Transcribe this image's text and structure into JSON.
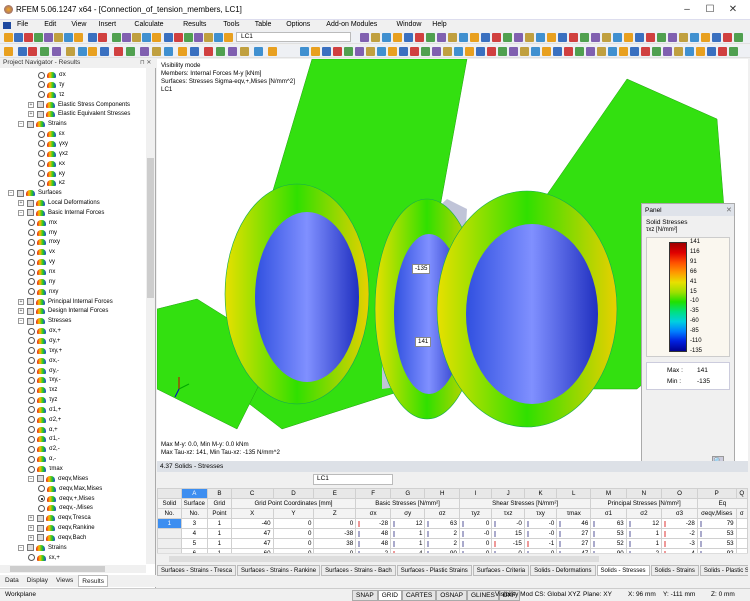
{
  "app": {
    "title": "RFEM 5.06.1247 x64 - [Connection_of_tension_members, LC1]"
  },
  "menu": [
    "File",
    "Edit",
    "View",
    "Insert",
    "Calculate",
    "Results",
    "Tools",
    "Table",
    "Options",
    "Add-on Modules",
    "Window",
    "Help"
  ],
  "toolbar": {
    "loadcase": "LC1"
  },
  "navigator": {
    "title": "Project Navigator - Results",
    "items": [
      {
        "l": 3,
        "t": "r",
        "label": "σx"
      },
      {
        "l": 3,
        "t": "r",
        "label": "τy"
      },
      {
        "l": 3,
        "t": "r",
        "label": "τz"
      },
      {
        "l": 2,
        "t": "e",
        "label": "Elastic Stress Components"
      },
      {
        "l": 2,
        "t": "e",
        "label": "Elastic Equivalent Stresses"
      },
      {
        "l": 1,
        "t": "c",
        "label": "Strains"
      },
      {
        "l": 3,
        "t": "r",
        "label": "εx"
      },
      {
        "l": 3,
        "t": "r",
        "label": "γxy"
      },
      {
        "l": 3,
        "t": "r",
        "label": "γxz"
      },
      {
        "l": 3,
        "t": "r",
        "label": "κx"
      },
      {
        "l": 3,
        "t": "r",
        "label": "κy"
      },
      {
        "l": 3,
        "t": "r",
        "label": "κz"
      },
      {
        "l": 0,
        "t": "c",
        "label": "Surfaces"
      },
      {
        "l": 1,
        "t": "e",
        "label": "Local Deformations"
      },
      {
        "l": 1,
        "t": "c",
        "label": "Basic Internal Forces"
      },
      {
        "l": 2,
        "t": "r",
        "label": "mx"
      },
      {
        "l": 2,
        "t": "r",
        "label": "my"
      },
      {
        "l": 2,
        "t": "r",
        "label": "mxy"
      },
      {
        "l": 2,
        "t": "r",
        "label": "vx"
      },
      {
        "l": 2,
        "t": "r",
        "label": "vy"
      },
      {
        "l": 2,
        "t": "r",
        "label": "nx"
      },
      {
        "l": 2,
        "t": "r",
        "label": "ny"
      },
      {
        "l": 2,
        "t": "r",
        "label": "nxy"
      },
      {
        "l": 1,
        "t": "e",
        "label": "Principal Internal Forces"
      },
      {
        "l": 1,
        "t": "e",
        "label": "Design Internal Forces"
      },
      {
        "l": 1,
        "t": "c",
        "label": "Stresses"
      },
      {
        "l": 2,
        "t": "r",
        "label": "σx,+"
      },
      {
        "l": 2,
        "t": "r",
        "label": "σy,+"
      },
      {
        "l": 2,
        "t": "r",
        "label": "τxy,+"
      },
      {
        "l": 2,
        "t": "r",
        "label": "σx,-"
      },
      {
        "l": 2,
        "t": "r",
        "label": "σy,-"
      },
      {
        "l": 2,
        "t": "r",
        "label": "τxy,-"
      },
      {
        "l": 2,
        "t": "r",
        "label": "τxz"
      },
      {
        "l": 2,
        "t": "r",
        "label": "τyz"
      },
      {
        "l": 2,
        "t": "r",
        "label": "σ1,+"
      },
      {
        "l": 2,
        "t": "r",
        "label": "σ2,+"
      },
      {
        "l": 2,
        "t": "r",
        "label": "α,+"
      },
      {
        "l": 2,
        "t": "r",
        "label": "σ1,-"
      },
      {
        "l": 2,
        "t": "r",
        "label": "σ2,-"
      },
      {
        "l": 2,
        "t": "r",
        "label": "α,-"
      },
      {
        "l": 2,
        "t": "r",
        "label": "τmax"
      },
      {
        "l": 2,
        "t": "c",
        "label": "σeqv,Mises"
      },
      {
        "l": 3,
        "t": "r",
        "label": "σeqv,Max,Mises"
      },
      {
        "l": 3,
        "t": "r",
        "label": "σeqv,+,Mises",
        "checked": true
      },
      {
        "l": 3,
        "t": "r",
        "label": "σeqv,-,Mises"
      },
      {
        "l": 2,
        "t": "e",
        "label": "σeqv,Tresca"
      },
      {
        "l": 2,
        "t": "e",
        "label": "σeqv,Rankine"
      },
      {
        "l": 2,
        "t": "e",
        "label": "σeqv,Bach"
      },
      {
        "l": 1,
        "t": "c",
        "label": "Strains"
      },
      {
        "l": 2,
        "t": "r",
        "label": "εx,+"
      }
    ],
    "tabs": [
      "Data",
      "Display",
      "Views",
      "Results"
    ],
    "active_tab": "Results"
  },
  "viewport": {
    "info": [
      "Visibility mode",
      "Members: Internal Forces M-y [kNm]",
      "Surfaces: Stresses Sigma-eqv,+,Mises [N/mm^2]",
      "LC1"
    ],
    "footer": [
      "Max M-y: 0.0, Min M-y: 0.0 kNm",
      "Max Tau-xz: 141, Min Tau-xz: -135 N/mm^2"
    ],
    "labels": [
      "-135",
      "141"
    ]
  },
  "panel": {
    "title": "Panel",
    "heading": "Solid Stresses",
    "unit": "τxz [N/mm²]",
    "scale": [
      "141",
      "116",
      "91",
      "66",
      "41",
      "15",
      "-10",
      "-35",
      "-60",
      "-85",
      "-110",
      "-135"
    ],
    "colors": [
      "#a00000",
      "#e00000",
      "#ff5000",
      "#ff9900",
      "#e8e000",
      "#a0e000",
      "#20e000",
      "#00e080",
      "#00d0e0",
      "#0080ff",
      "#0020e0",
      "#000090"
    ],
    "max_label": "Max :",
    "max": "141",
    "min_label": "Min :",
    "min": "-135"
  },
  "table": {
    "title": "4.37 Solids - Stresses",
    "loadcase": "LC1",
    "col_letters": [
      "A",
      "B",
      "C",
      "D",
      "E",
      "F",
      "G",
      "H",
      "I",
      "J",
      "K",
      "L",
      "M",
      "N",
      "O",
      "P",
      "Q"
    ],
    "groups": [
      "Grid Point Coordinates [mm]",
      "Basic Stresses [N/mm²]",
      "Shear Stresses [N/mm²]",
      "Principal Stresses [N/mm²]",
      "Eq"
    ],
    "headers_top": [
      "Solid",
      "Surface",
      "Grid"
    ],
    "headers_bottom": [
      "No.",
      "No.",
      "Point",
      "X",
      "Y",
      "Z",
      "σx",
      "σy",
      "σz",
      "τyz",
      "τxz",
      "τxy",
      "τmax",
      "σ1",
      "σ2",
      "σ3",
      "σeqv,Mises",
      "σ"
    ],
    "rows": [
      [
        "1",
        "3",
        "1",
        "-40",
        "0",
        "0",
        "-28",
        "12",
        "63",
        "0",
        "-0",
        "-0",
        "46",
        "63",
        "12",
        "-28",
        "79"
      ],
      [
        "",
        "4",
        "1",
        "47",
        "0",
        "-38",
        "48",
        "1",
        "2",
        "-0",
        "15",
        "-0",
        "27",
        "53",
        "1",
        "-2",
        "53"
      ],
      [
        "",
        "5",
        "1",
        "47",
        "0",
        "38",
        "48",
        "1",
        "2",
        "0",
        "-15",
        "-1",
        "27",
        "52",
        "1",
        "-3",
        "53"
      ],
      [
        "",
        "6",
        "1",
        "-60",
        "0",
        "0",
        "2",
        "-4",
        "90",
        "0",
        "-0",
        "-0",
        "47",
        "90",
        "2",
        "-4",
        "92"
      ]
    ],
    "tabs": [
      "Surfaces - Strains - Tresca",
      "Surfaces - Strains - Rankine",
      "Surfaces - Strains - Bach",
      "Surfaces - Plastic Strains",
      "Surfaces - Criteria",
      "Solids - Deformations",
      "Solids - Stresses",
      "Solids - Strains",
      "Solids - Plastic Strains"
    ],
    "active_tab": "Solids - Stresses"
  },
  "status": {
    "workplane": "Workplane",
    "toggles": [
      "SNAP",
      "GRID",
      "CARTES",
      "OSNAP",
      "GLINES",
      "DXF"
    ],
    "active": [
      "GRID"
    ],
    "cs": "Visibility Mod CS: Global XYZ",
    "plane": "Plane: XY",
    "x": "X: 96 mm",
    "y": "Y: -111 mm",
    "z": "Z: 0 mm"
  }
}
